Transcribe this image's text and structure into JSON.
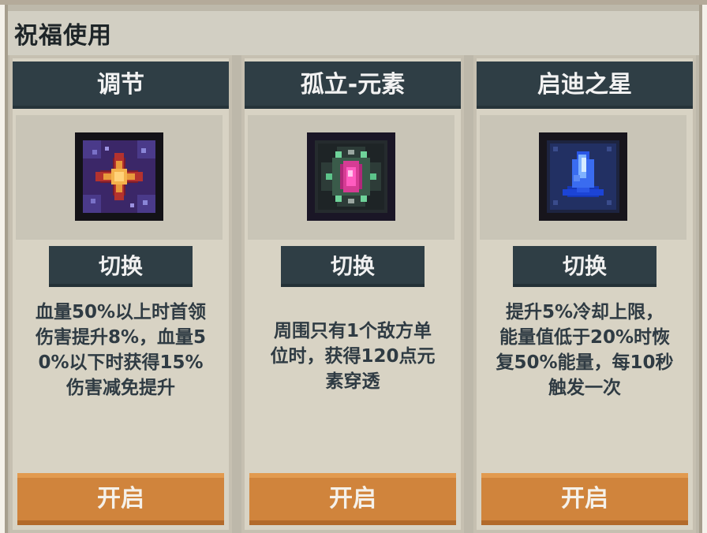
{
  "panel": {
    "title": "祝福使用"
  },
  "cards": [
    {
      "title": "调节",
      "icon": "orange-star-blessing-icon",
      "switch_label": "切换",
      "description": [
        "血量50%以上时首领",
        "伤害提升8%，血量5",
        "0%以下时获得15%",
        "伤害减免提升"
      ],
      "open_label": "开启"
    },
    {
      "title": "孤立-元素",
      "icon": "pink-gem-element-icon",
      "switch_label": "切换",
      "description": [
        "周围只有1个敌方单",
        "位时，获得120点元",
        "素穿透"
      ],
      "open_label": "开启"
    },
    {
      "title": "启迪之星",
      "icon": "blue-crystal-star-icon",
      "switch_label": "切换",
      "description": [
        "提升5%冷却上限，",
        "能量值低于20%时恢",
        "复50%能量，每10秒",
        "触发一次"
      ],
      "open_label": "开启"
    }
  ],
  "colors": {
    "card_header": "#2f3e45",
    "open_button": "#d0843c",
    "text_dark": "#2f3b43"
  }
}
